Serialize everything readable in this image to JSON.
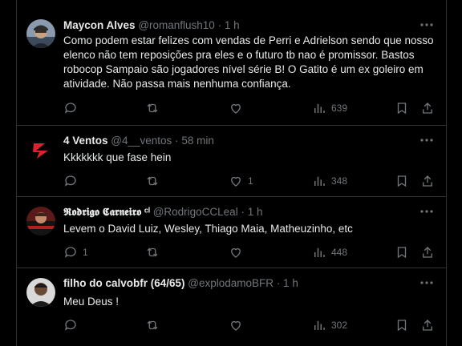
{
  "tweets": [
    {
      "name": "Maycon Alves",
      "handle": "@romanflush10",
      "time": "· 1 h",
      "text": "Como podem estar felizes com vendas de Perri e Adrielson sendo que nosso elenco não tem reposições pra eles e o futuro tb nao é promissor. Bastos robocop Sampaio são jogadores nível série B! O Gatito é um ex goleiro em atividade. Não passa mais nenhuma confiança.",
      "replies": "",
      "reposts": "",
      "likes": "",
      "views": "639"
    },
    {
      "name": "4 Ventos",
      "handle": "@4__ventos",
      "time": "· 58 min",
      "text": "Kkkkkkk que fase hein",
      "replies": "",
      "reposts": "",
      "likes": "1",
      "views": "348"
    },
    {
      "name": "𝕽𝖔𝖉𝖗𝖎𝖌𝖔 𝕮𝖆𝖗𝖓𝖊𝖎𝖗𝖔 ᶜˡ",
      "handle": "@RodrigoCCLeal",
      "time": "· 1 h",
      "text": "Levem o David Luiz, Wesley, Thiago Maia, Matheuzinho, etc",
      "replies": "1",
      "reposts": "",
      "likes": "",
      "views": "448"
    },
    {
      "name": "filho do calvobfr (64/65)",
      "handle": "@explodamoBFR",
      "time": "· 1 h",
      "text": "Meu Deus !",
      "replies": "",
      "reposts": "",
      "likes": "",
      "views": "302"
    }
  ],
  "colors": {
    "background": "#000000",
    "text_primary": "#e7e9ea",
    "text_secondary": "#71767b",
    "divider": "#2f3336"
  },
  "icons": [
    "reply-icon",
    "repost-icon",
    "like-icon",
    "views-icon",
    "bookmark-icon",
    "share-icon",
    "more-icon"
  ]
}
